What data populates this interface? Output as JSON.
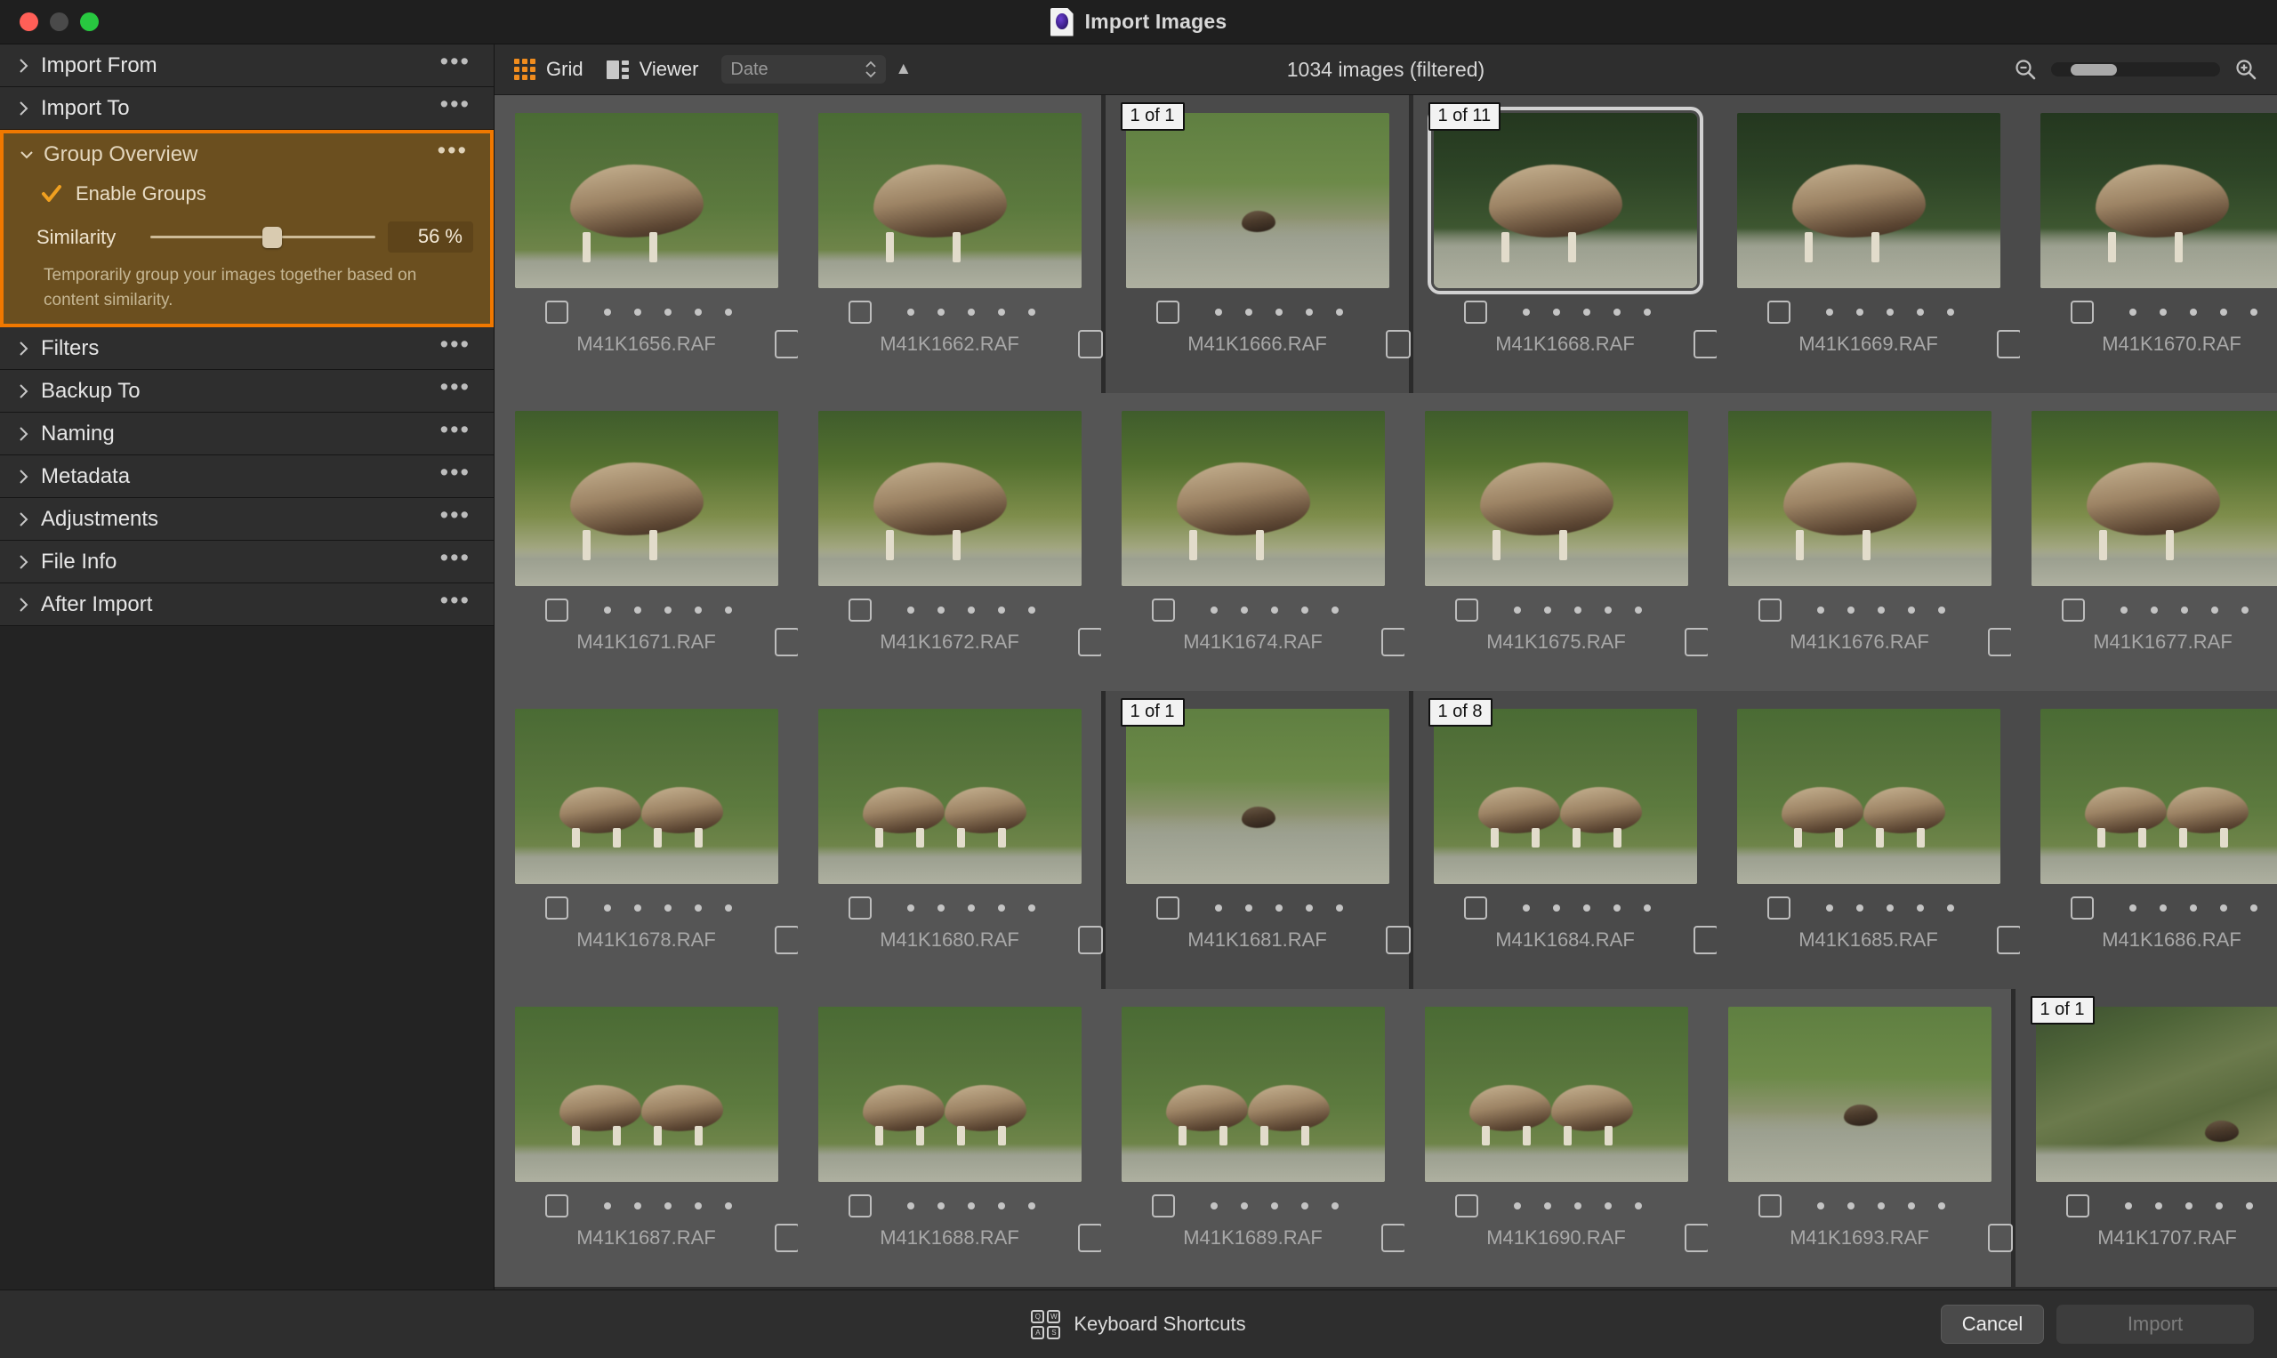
{
  "window": {
    "title": "Import Images",
    "icon": "app-document-icon",
    "traffic_lights": [
      "close",
      "minimize",
      "zoom"
    ]
  },
  "sidebar": {
    "sections": [
      {
        "label": "Import From",
        "expanded": false,
        "menu": "…"
      },
      {
        "label": "Import To",
        "expanded": false,
        "menu": "…"
      },
      {
        "label": "Group Overview",
        "expanded": true,
        "menu": "…",
        "highlighted": true
      },
      {
        "label": "Filters",
        "expanded": false,
        "menu": "…"
      },
      {
        "label": "Backup To",
        "expanded": false,
        "menu": "…"
      },
      {
        "label": "Naming",
        "expanded": false,
        "menu": "…"
      },
      {
        "label": "Metadata",
        "expanded": false,
        "menu": "…"
      },
      {
        "label": "Adjustments",
        "expanded": false,
        "menu": "…"
      },
      {
        "label": "File Info",
        "expanded": false,
        "menu": "…"
      },
      {
        "label": "After Import",
        "expanded": false,
        "menu": "…"
      }
    ],
    "group_overview": {
      "title": "Group Overview",
      "menu": "…",
      "enable_groups_label": "Enable Groups",
      "enable_groups_checked": true,
      "similarity_label": "Similarity",
      "similarity_value": "56 %",
      "similarity_percent": 56,
      "description": "Temporarily group your images together based on content similarity.",
      "highlight_color": "#f07800",
      "panel_color": "#6b4f1f"
    }
  },
  "toolbar": {
    "grid_label": "Grid",
    "viewer_label": "Viewer",
    "grid_active": true,
    "sort_value": "Date",
    "sort_direction": "▲",
    "count_text": "1034 images (filtered)",
    "zoom_out_icon": "zoom-out-icon",
    "zoom_in_icon": "zoom-in-icon",
    "zoom_slider_percent": 20,
    "accent_color": "#f08c1e"
  },
  "grid": {
    "rows": [
      [
        {
          "file": "M41K1656.RAF",
          "badge": null,
          "group": false,
          "selected": false,
          "scene": "sky-green",
          "rating": 5
        },
        {
          "file": "M41K1662.RAF",
          "badge": null,
          "group": false,
          "selected": false,
          "scene": "sky-green",
          "rating": 5
        },
        {
          "file": "M41K1666.RAF",
          "badge": "1 of 1",
          "group": true,
          "selected": false,
          "scene": "sky-rock",
          "rating": 5
        },
        {
          "file": "M41K1668.RAF",
          "badge": "1 of 11",
          "group": true,
          "selected": true,
          "scene": "sky-dark",
          "rating": 5
        },
        {
          "file": "M41K1669.RAF",
          "badge": null,
          "group": true,
          "selected": false,
          "scene": "sky-dark",
          "rating": 5
        },
        {
          "file": "M41K1670.RAF",
          "badge": null,
          "group": true,
          "selected": false,
          "scene": "sky-dark",
          "rating": 5
        }
      ],
      [
        {
          "file": "M41K1671.RAF",
          "badge": null,
          "group": false,
          "selected": false,
          "scene": "sky-moss",
          "rating": 5
        },
        {
          "file": "M41K1672.RAF",
          "badge": null,
          "group": false,
          "selected": false,
          "scene": "sky-moss",
          "rating": 5
        },
        {
          "file": "M41K1674.RAF",
          "badge": null,
          "group": false,
          "selected": false,
          "scene": "sky-moss",
          "rating": 5
        },
        {
          "file": "M41K1675.RAF",
          "badge": null,
          "group": false,
          "selected": false,
          "scene": "sky-moss",
          "rating": 5
        },
        {
          "file": "M41K1676.RAF",
          "badge": null,
          "group": false,
          "selected": false,
          "scene": "sky-moss",
          "rating": 5
        },
        {
          "file": "M41K1677.RAF",
          "badge": null,
          "group": false,
          "selected": false,
          "scene": "sky-moss",
          "rating": 5
        }
      ],
      [
        {
          "file": "M41K1678.RAF",
          "badge": null,
          "group": false,
          "selected": false,
          "scene": "sky-green",
          "rating": 5
        },
        {
          "file": "M41K1680.RAF",
          "badge": null,
          "group": false,
          "selected": false,
          "scene": "sky-green",
          "rating": 5
        },
        {
          "file": "M41K1681.RAF",
          "badge": "1 of 1",
          "group": true,
          "selected": false,
          "scene": "sky-rock",
          "rating": 5
        },
        {
          "file": "M41K1684.RAF",
          "badge": "1 of 8",
          "group": true,
          "selected": false,
          "scene": "sky-green",
          "rating": 5
        },
        {
          "file": "M41K1685.RAF",
          "badge": null,
          "group": true,
          "selected": false,
          "scene": "sky-green",
          "rating": 5
        },
        {
          "file": "M41K1686.RAF",
          "badge": null,
          "group": true,
          "selected": false,
          "scene": "sky-green",
          "rating": 5
        }
      ],
      [
        {
          "file": "M41K1687.RAF",
          "badge": null,
          "group": false,
          "selected": false,
          "scene": "sky-green",
          "rating": 5
        },
        {
          "file": "M41K1688.RAF",
          "badge": null,
          "group": false,
          "selected": false,
          "scene": "sky-green",
          "rating": 5
        },
        {
          "file": "M41K1689.RAF",
          "badge": null,
          "group": false,
          "selected": false,
          "scene": "sky-green",
          "rating": 5
        },
        {
          "file": "M41K1690.RAF",
          "badge": null,
          "group": false,
          "selected": false,
          "scene": "sky-green",
          "rating": 5
        },
        {
          "file": "M41K1693.RAF",
          "badge": null,
          "group": false,
          "selected": false,
          "scene": "sky-rock",
          "rating": 5
        },
        {
          "file": "M41K1707.RAF",
          "badge": "1 of 1",
          "group": true,
          "selected": false,
          "scene": "sky-hill",
          "rating": 5
        }
      ]
    ]
  },
  "footer": {
    "keyboard_shortcuts_label": "Keyboard Shortcuts",
    "keyboard_keys": [
      "Q",
      "W",
      "A",
      "S"
    ],
    "cancel_label": "Cancel",
    "import_label": "Import",
    "import_enabled": false
  }
}
